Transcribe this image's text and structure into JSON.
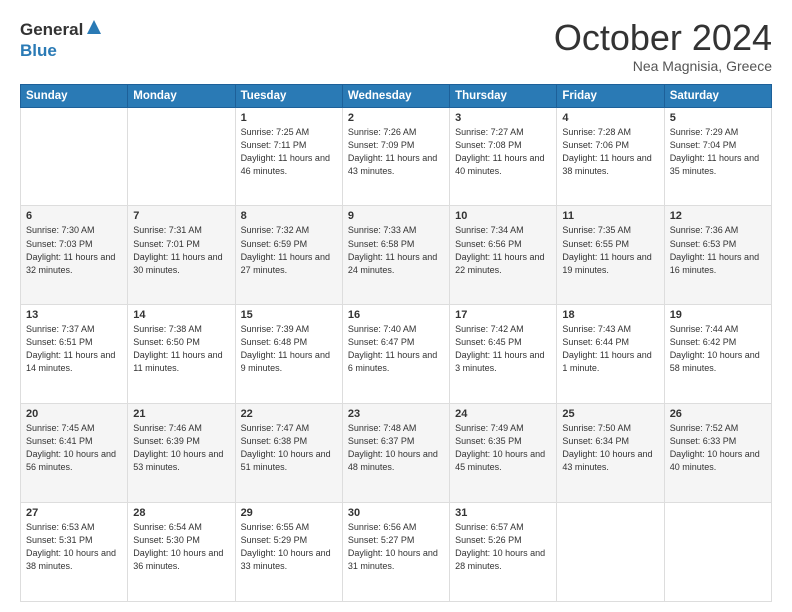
{
  "header": {
    "logo_general": "General",
    "logo_blue": "Blue",
    "month": "October 2024",
    "location": "Nea Magnisia, Greece"
  },
  "days_of_week": [
    "Sunday",
    "Monday",
    "Tuesday",
    "Wednesday",
    "Thursday",
    "Friday",
    "Saturday"
  ],
  "weeks": [
    [
      {
        "day": "",
        "info": ""
      },
      {
        "day": "",
        "info": ""
      },
      {
        "day": "1",
        "info": "Sunrise: 7:25 AM\nSunset: 7:11 PM\nDaylight: 11 hours and 46 minutes."
      },
      {
        "day": "2",
        "info": "Sunrise: 7:26 AM\nSunset: 7:09 PM\nDaylight: 11 hours and 43 minutes."
      },
      {
        "day": "3",
        "info": "Sunrise: 7:27 AM\nSunset: 7:08 PM\nDaylight: 11 hours and 40 minutes."
      },
      {
        "day": "4",
        "info": "Sunrise: 7:28 AM\nSunset: 7:06 PM\nDaylight: 11 hours and 38 minutes."
      },
      {
        "day": "5",
        "info": "Sunrise: 7:29 AM\nSunset: 7:04 PM\nDaylight: 11 hours and 35 minutes."
      }
    ],
    [
      {
        "day": "6",
        "info": "Sunrise: 7:30 AM\nSunset: 7:03 PM\nDaylight: 11 hours and 32 minutes."
      },
      {
        "day": "7",
        "info": "Sunrise: 7:31 AM\nSunset: 7:01 PM\nDaylight: 11 hours and 30 minutes."
      },
      {
        "day": "8",
        "info": "Sunrise: 7:32 AM\nSunset: 6:59 PM\nDaylight: 11 hours and 27 minutes."
      },
      {
        "day": "9",
        "info": "Sunrise: 7:33 AM\nSunset: 6:58 PM\nDaylight: 11 hours and 24 minutes."
      },
      {
        "day": "10",
        "info": "Sunrise: 7:34 AM\nSunset: 6:56 PM\nDaylight: 11 hours and 22 minutes."
      },
      {
        "day": "11",
        "info": "Sunrise: 7:35 AM\nSunset: 6:55 PM\nDaylight: 11 hours and 19 minutes."
      },
      {
        "day": "12",
        "info": "Sunrise: 7:36 AM\nSunset: 6:53 PM\nDaylight: 11 hours and 16 minutes."
      }
    ],
    [
      {
        "day": "13",
        "info": "Sunrise: 7:37 AM\nSunset: 6:51 PM\nDaylight: 11 hours and 14 minutes."
      },
      {
        "day": "14",
        "info": "Sunrise: 7:38 AM\nSunset: 6:50 PM\nDaylight: 11 hours and 11 minutes."
      },
      {
        "day": "15",
        "info": "Sunrise: 7:39 AM\nSunset: 6:48 PM\nDaylight: 11 hours and 9 minutes."
      },
      {
        "day": "16",
        "info": "Sunrise: 7:40 AM\nSunset: 6:47 PM\nDaylight: 11 hours and 6 minutes."
      },
      {
        "day": "17",
        "info": "Sunrise: 7:42 AM\nSunset: 6:45 PM\nDaylight: 11 hours and 3 minutes."
      },
      {
        "day": "18",
        "info": "Sunrise: 7:43 AM\nSunset: 6:44 PM\nDaylight: 11 hours and 1 minute."
      },
      {
        "day": "19",
        "info": "Sunrise: 7:44 AM\nSunset: 6:42 PM\nDaylight: 10 hours and 58 minutes."
      }
    ],
    [
      {
        "day": "20",
        "info": "Sunrise: 7:45 AM\nSunset: 6:41 PM\nDaylight: 10 hours and 56 minutes."
      },
      {
        "day": "21",
        "info": "Sunrise: 7:46 AM\nSunset: 6:39 PM\nDaylight: 10 hours and 53 minutes."
      },
      {
        "day": "22",
        "info": "Sunrise: 7:47 AM\nSunset: 6:38 PM\nDaylight: 10 hours and 51 minutes."
      },
      {
        "day": "23",
        "info": "Sunrise: 7:48 AM\nSunset: 6:37 PM\nDaylight: 10 hours and 48 minutes."
      },
      {
        "day": "24",
        "info": "Sunrise: 7:49 AM\nSunset: 6:35 PM\nDaylight: 10 hours and 45 minutes."
      },
      {
        "day": "25",
        "info": "Sunrise: 7:50 AM\nSunset: 6:34 PM\nDaylight: 10 hours and 43 minutes."
      },
      {
        "day": "26",
        "info": "Sunrise: 7:52 AM\nSunset: 6:33 PM\nDaylight: 10 hours and 40 minutes."
      }
    ],
    [
      {
        "day": "27",
        "info": "Sunrise: 6:53 AM\nSunset: 5:31 PM\nDaylight: 10 hours and 38 minutes."
      },
      {
        "day": "28",
        "info": "Sunrise: 6:54 AM\nSunset: 5:30 PM\nDaylight: 10 hours and 36 minutes."
      },
      {
        "day": "29",
        "info": "Sunrise: 6:55 AM\nSunset: 5:29 PM\nDaylight: 10 hours and 33 minutes."
      },
      {
        "day": "30",
        "info": "Sunrise: 6:56 AM\nSunset: 5:27 PM\nDaylight: 10 hours and 31 minutes."
      },
      {
        "day": "31",
        "info": "Sunrise: 6:57 AM\nSunset: 5:26 PM\nDaylight: 10 hours and 28 minutes."
      },
      {
        "day": "",
        "info": ""
      },
      {
        "day": "",
        "info": ""
      }
    ]
  ]
}
